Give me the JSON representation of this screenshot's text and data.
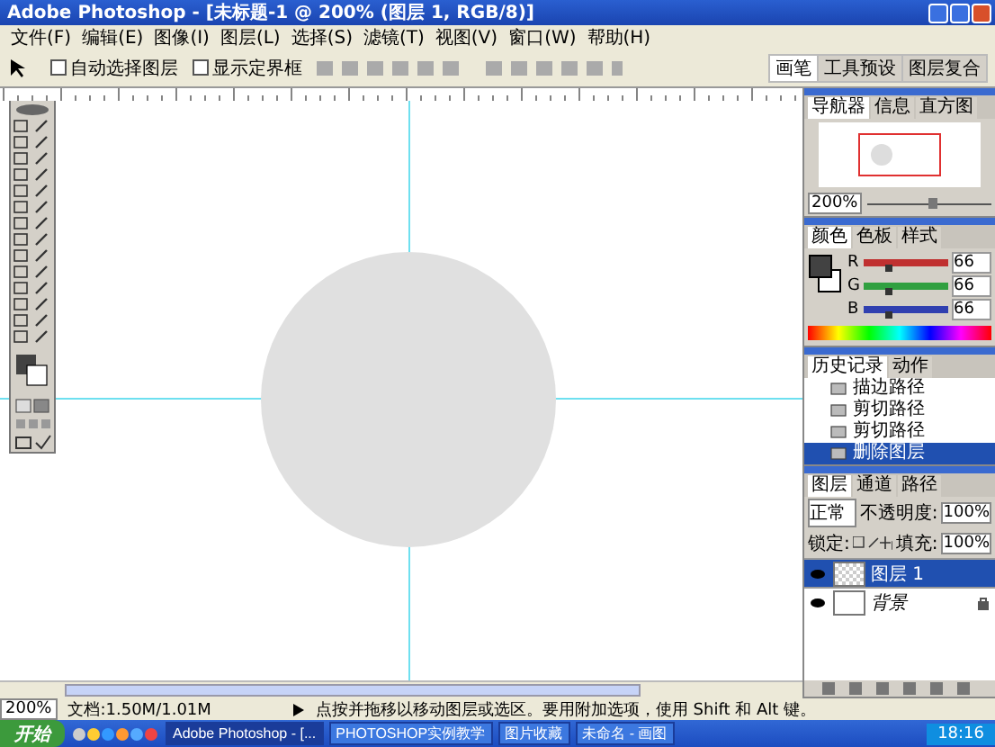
{
  "window": {
    "title": "Adobe Photoshop - [未标题-1 @ 200% (图层 1, RGB/8)]"
  },
  "menu": [
    "文件(F)",
    "编辑(E)",
    "图像(I)",
    "图层(L)",
    "选择(S)",
    "滤镜(T)",
    "视图(V)",
    "窗口(W)",
    "帮助(H)"
  ],
  "options": [
    {
      "label": "自动选择图层",
      "checked": false
    },
    {
      "label": "显示定界框",
      "checked": false
    }
  ],
  "palette_well": [
    {
      "label": "画笔",
      "selected": true
    },
    {
      "label": "工具预设",
      "selected": false
    },
    {
      "label": "图层复合",
      "selected": false
    }
  ],
  "navigator": {
    "tabs": [
      {
        "label": "导航器",
        "selected": true
      },
      {
        "label": "信息",
        "selected": false
      },
      {
        "label": "直方图",
        "selected": false
      }
    ],
    "zoom": "200%",
    "level": 0.5
  },
  "color": {
    "tabs": [
      {
        "label": "颜色",
        "selected": true
      },
      {
        "label": "色板",
        "selected": false
      },
      {
        "label": "样式",
        "selected": false
      }
    ],
    "channels": [
      {
        "name": "R",
        "value": "66",
        "level": 0.26,
        "color": "#c03030"
      },
      {
        "name": "G",
        "value": "66",
        "level": 0.26,
        "color": "#30a040"
      },
      {
        "name": "B",
        "value": "66",
        "level": 0.26,
        "color": "#3040b0"
      }
    ]
  },
  "history": {
    "tabs": [
      {
        "label": "历史记录",
        "selected": true
      },
      {
        "label": "动作",
        "selected": false
      }
    ],
    "items": [
      {
        "label": "描边路径",
        "selected": false
      },
      {
        "label": "剪切路径",
        "selected": false
      },
      {
        "label": "剪切路径",
        "selected": false
      },
      {
        "label": "删除图层",
        "selected": true
      }
    ]
  },
  "layers": {
    "tabs": [
      {
        "label": "图层",
        "selected": true
      },
      {
        "label": "通道",
        "selected": false
      },
      {
        "label": "路径",
        "selected": false
      }
    ],
    "blend": "正常",
    "opacity_label": "不透明度:",
    "opacity": "100%",
    "lock_label": "锁定:",
    "fill_label": "填充:",
    "fill": "100%",
    "items": [
      {
        "name": "图层 1",
        "selected": true,
        "visible": true,
        "locked": false,
        "italic": false
      },
      {
        "name": "背景",
        "selected": false,
        "visible": true,
        "locked": true,
        "italic": true
      }
    ]
  },
  "status_bar": {
    "zoom": "200%",
    "doc": "文档:1.50M/1.01M",
    "hint": "点按并拖移以移动图层或选区。要用附加选项，使用 Shift 和 Alt 键。"
  },
  "taskbar": {
    "start": "开始",
    "tasks": [
      {
        "label": "Adobe Photoshop - [...",
        "selected": true
      },
      {
        "label": "PHOTOSHOP实例教学",
        "selected": false
      },
      {
        "label": "图片收藏",
        "selected": false
      },
      {
        "label": "未命名 - 画图",
        "selected": false
      }
    ],
    "clock": "18:16"
  }
}
